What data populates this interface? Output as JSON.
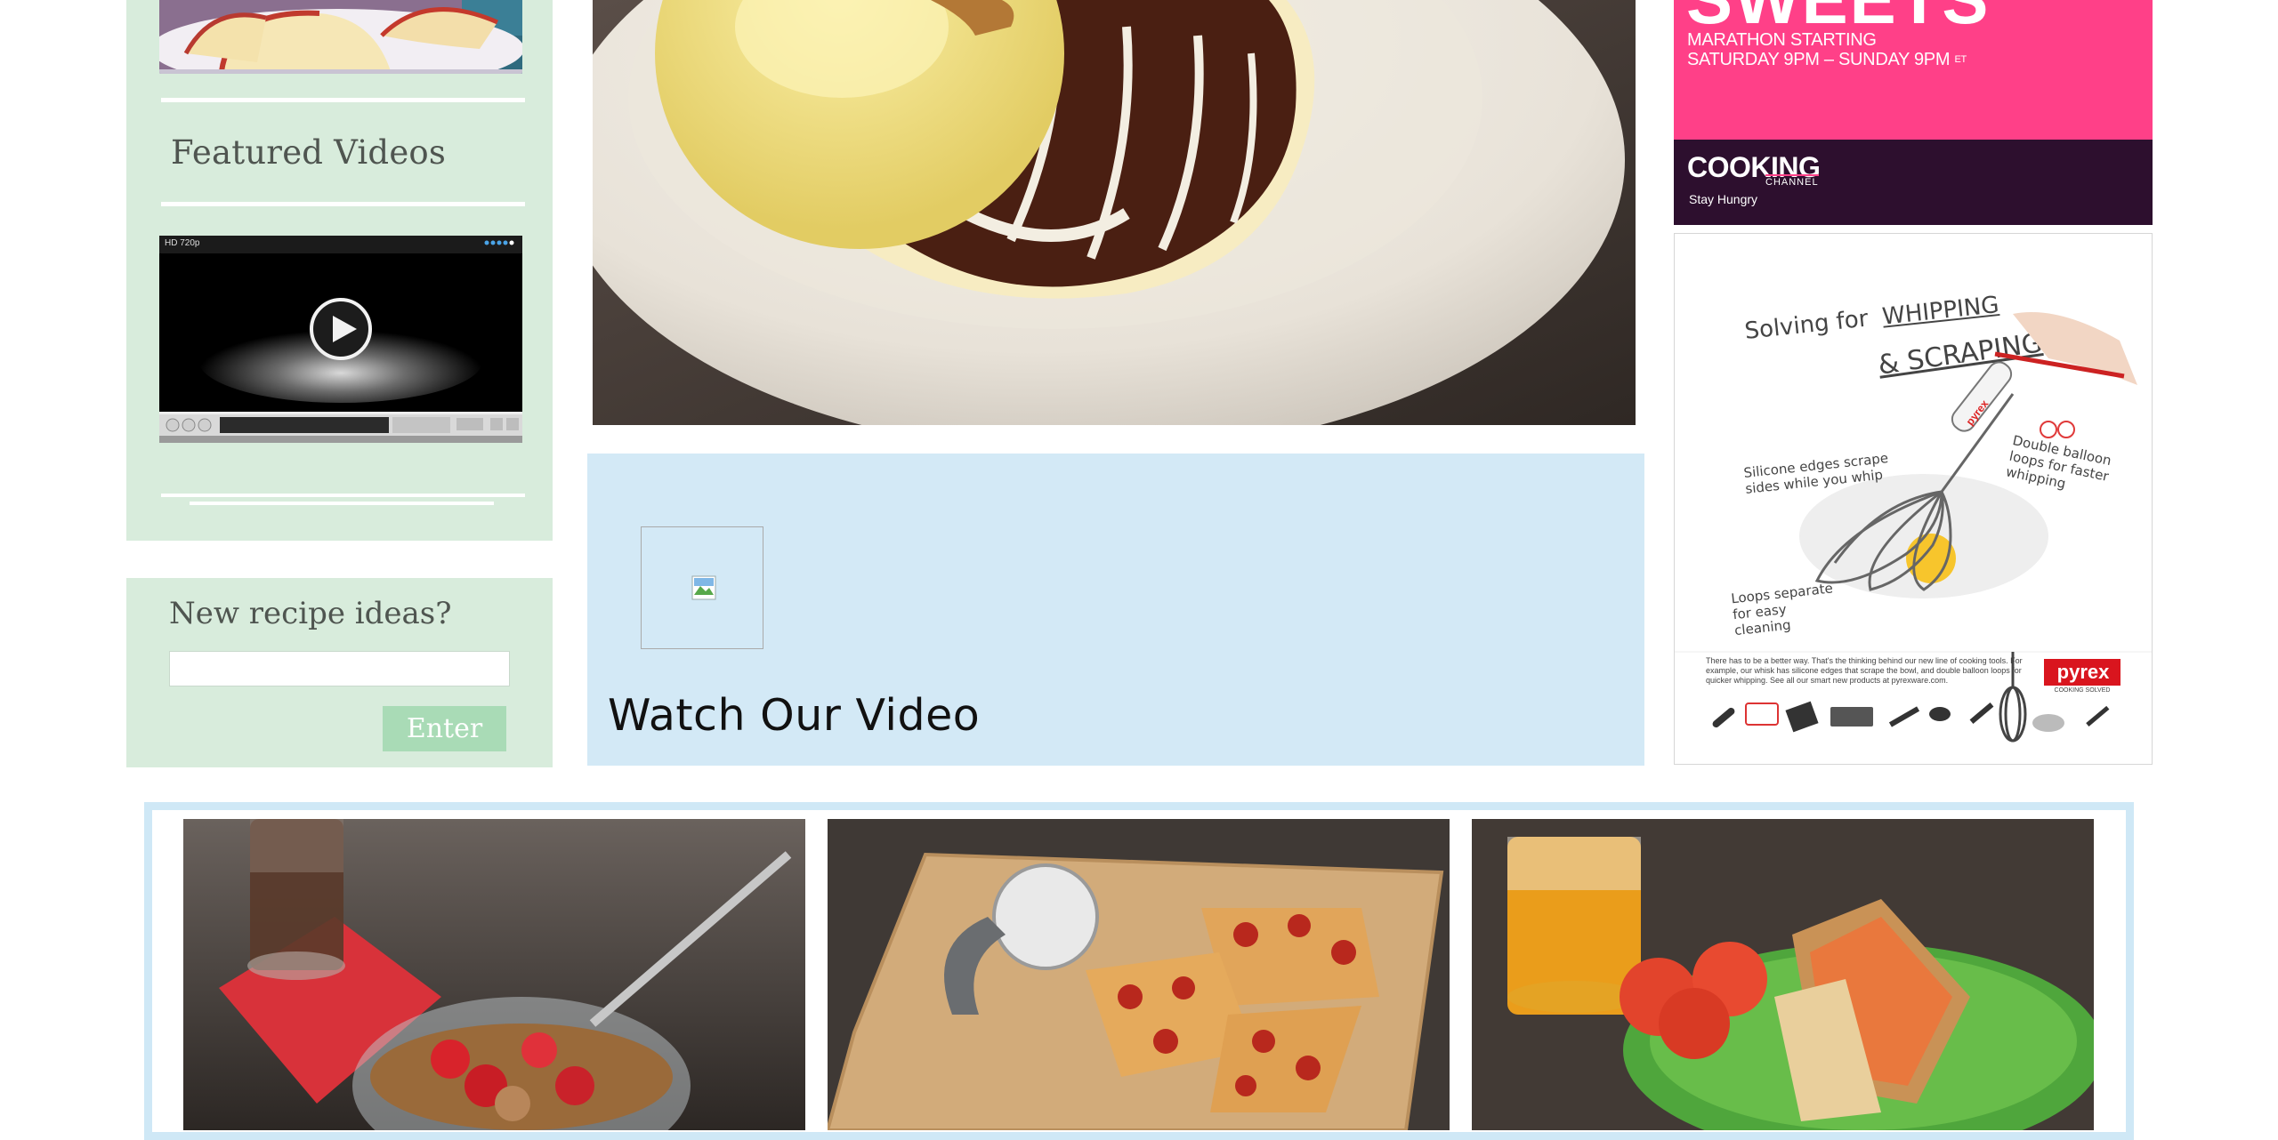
{
  "sidebar": {
    "featured_title": "Featured Videos",
    "video_player": {
      "quality_badge": "HD 720p"
    }
  },
  "newsletter": {
    "title": "New recipe ideas?",
    "input_value": "",
    "input_placeholder": "",
    "enter_label": "Enter"
  },
  "video_panel": {
    "title": "Watch Our Video"
  },
  "ads": {
    "cooking_channel": {
      "headline": "SWEETS",
      "line1": "MARATHON STARTING",
      "line2": "SATURDAY 9PM – SUNDAY 9PM",
      "timezone": "ET",
      "logo": "COOKING",
      "logo_sub": "CHANNEL",
      "tagline": "Stay Hungry",
      "colors": {
        "pink": "#ff4088",
        "dark": "#2d0f2e"
      }
    },
    "pyrex": {
      "heading_line1": "Solving for",
      "heading_whipping": "WHIPPING",
      "heading_line2": "& SCRAPING",
      "note_silicone": "Silicone edges scrape sides while you whip",
      "note_balloon": "Double balloon loops for faster whipping",
      "note_loops": "Loops separate for easy cleaning",
      "brand_on_whisk": "pyrex",
      "body_text": "There has to be a better way. That's the thinking behind our new line of cooking tools. For example, our whisk has silicone edges that scrape the bowl, and double balloon loops for quicker whipping. See all our smart new products at pyrexware.com.",
      "logo": "pyrex",
      "logo_sub": "COOKING SOLVED",
      "colors": {
        "red": "#d9151e"
      }
    }
  },
  "images": {
    "hero": "plated-dessert-with-sauce",
    "apple": "sliced-apples",
    "bottom": [
      "cereal-bowl-with-strawberries",
      "sliced-pepperoni-pizza",
      "toasted-sandwich-with-tomatoes"
    ]
  },
  "colors": {
    "sidebar_bg": "#d8ecdc",
    "enter_button": "#a9dbb6",
    "video_panel_bg": "#d3e9f6",
    "bottom_frame": "#cfe8f6"
  }
}
